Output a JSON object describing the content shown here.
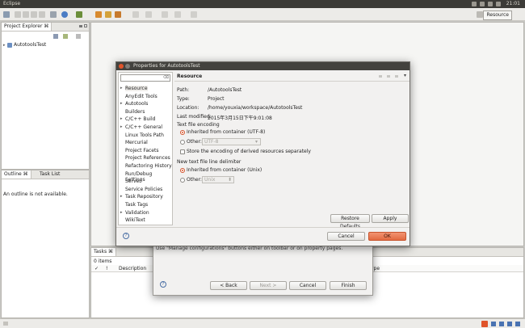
{
  "app": {
    "title": "Eclipse",
    "clock": "21:01"
  },
  "toolbar": {
    "perspective": "Resource"
  },
  "project_explorer": {
    "tab": "Project Explorer",
    "tab_tag": "⌘",
    "items": [
      {
        "label": "AutotoolsTest"
      }
    ]
  },
  "outline": {
    "tabs": [
      "Outline",
      "Task List"
    ],
    "tab_tag": "⌘",
    "message": "An outline is not available."
  },
  "tasks_view": {
    "tab": "Tasks",
    "tab_tag": "⌘",
    "count": "0 items",
    "columns": [
      "✓",
      "!",
      "Description",
      "ype"
    ]
  },
  "back_dialog": {
    "message": "Use \"Manage configurations\" buttons either on toolbar or on property pages.",
    "buttons": {
      "back": "< Back",
      "next": "Next >",
      "cancel": "Cancel",
      "finish": "Finish"
    }
  },
  "properties_dialog": {
    "title": "Properties for AutotoolsTest",
    "nav_items": [
      {
        "label": "Resource",
        "arrow": "▸"
      },
      {
        "label": "AnyEdit Tools",
        "arrow": ""
      },
      {
        "label": "Autotools",
        "arrow": "▸"
      },
      {
        "label": "Builders",
        "arrow": ""
      },
      {
        "label": "C/C++ Build",
        "arrow": "▸"
      },
      {
        "label": "C/C++ General",
        "arrow": "▸"
      },
      {
        "label": "Linux Tools Path",
        "arrow": ""
      },
      {
        "label": "Mercurial",
        "arrow": ""
      },
      {
        "label": "Project Facets",
        "arrow": ""
      },
      {
        "label": "Project References",
        "arrow": ""
      },
      {
        "label": "Refactoring History",
        "arrow": ""
      },
      {
        "label": "Run/Debug Settings",
        "arrow": ""
      },
      {
        "label": "Server",
        "arrow": ""
      },
      {
        "label": "Service Policies",
        "arrow": ""
      },
      {
        "label": "Task Repository",
        "arrow": "▸"
      },
      {
        "label": "Task Tags",
        "arrow": ""
      },
      {
        "label": "Validation",
        "arrow": "▸"
      },
      {
        "label": "WikiText",
        "arrow": ""
      }
    ],
    "page_title": "Resource",
    "info": [
      {
        "label": "Path:",
        "value": "/AutotoolsTest"
      },
      {
        "label": "Type:",
        "value": "Project"
      },
      {
        "label": "Location:",
        "value": "/home/youxia/workspace/AutotoolsTest"
      },
      {
        "label": "Last modified:",
        "value": "2015年3月15日下午9:01:08"
      }
    ],
    "encoding": {
      "group": "Text file encoding",
      "inherited": "Inherited from container (UTF-8)",
      "other": "Other:",
      "other_value": "UTF-8",
      "store": "Store the encoding of derived resources separately"
    },
    "delimiter": {
      "group": "New text file line delimiter",
      "inherited": "Inherited from container (Unix)",
      "other": "Other:",
      "other_value": "Unix"
    },
    "buttons": {
      "restore": "Restore Defaults",
      "apply": "Apply",
      "cancel": "Cancel",
      "ok": "OK"
    }
  },
  "colors": {
    "accent": "#e05a2c",
    "titlebar": "#43423e"
  }
}
